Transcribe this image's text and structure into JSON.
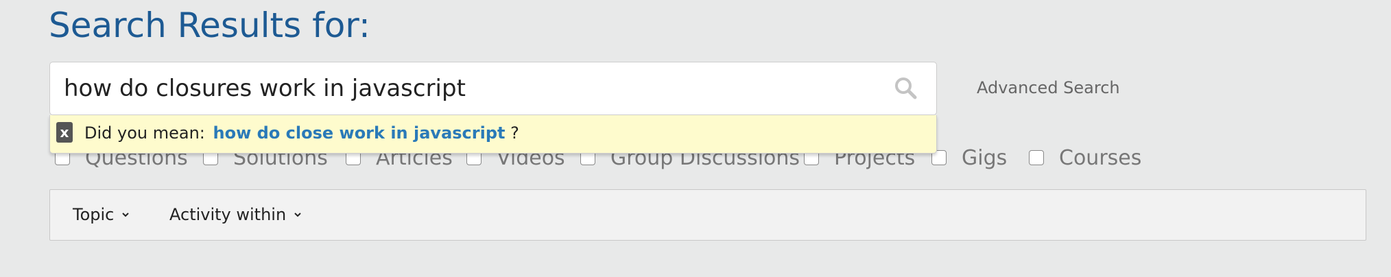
{
  "page": {
    "title": "Search Results for:"
  },
  "search": {
    "query": "how do closures work in javascript",
    "advanced_label": "Advanced Search"
  },
  "suggestion": {
    "dismiss_label": "x",
    "prefix": "Did you mean:",
    "link_text": "how do close work in javascript",
    "suffix": "?"
  },
  "content_types": [
    {
      "label": "Questions",
      "checked": false
    },
    {
      "label": "Solutions",
      "checked": false
    },
    {
      "label": "Articles",
      "checked": false
    },
    {
      "label": "Videos",
      "checked": false
    },
    {
      "label": "Group Discussions",
      "checked": false
    },
    {
      "label": "Projects",
      "checked": false
    },
    {
      "label": "Gigs",
      "checked": false
    },
    {
      "label": "Courses",
      "checked": false
    }
  ],
  "filter_bar": {
    "topic_label": "Topic",
    "activity_label": "Activity within"
  },
  "colors": {
    "title": "#1d5a93",
    "link": "#2a7ab8",
    "suggestion_bg": "#fefbcd",
    "page_bg": "#e8e9e9"
  },
  "icons": {
    "search": "search-icon",
    "chevron": "chevron-down-icon"
  }
}
